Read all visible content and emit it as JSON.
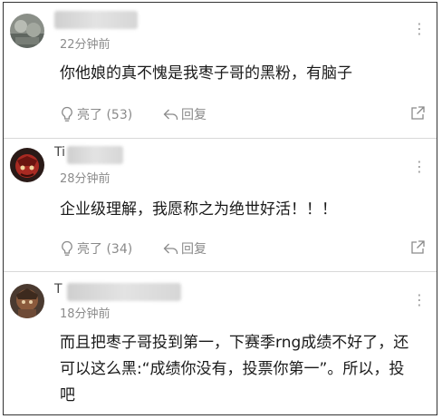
{
  "comments": [
    {
      "time": "22分钟前",
      "content": "你他娘的真不愧是我枣子哥的黑粉，有脑子",
      "like_label": "亮了 (53)",
      "reply_label": "回复"
    },
    {
      "name_visible": "Ti",
      "time": "28分钟前",
      "content": "企业级理解，我愿称之为绝世好活！！！",
      "like_label": "亮了 (34)",
      "reply_label": "回复"
    },
    {
      "name_visible": "T",
      "time": "18分钟前",
      "content": "而且把枣子哥投到第一，下赛季rng成绩不好了，还可以这么黑:“成绩你没有，投票你第一”。所以，投吧"
    }
  ],
  "icons": {
    "more": "more-vertical-icon",
    "like": "lightbulb-icon",
    "reply": "reply-arrow-icon",
    "share": "share-icon"
  },
  "colors": {
    "meta_text": "#8c8c8c",
    "action_text": "#8a8a8a"
  }
}
